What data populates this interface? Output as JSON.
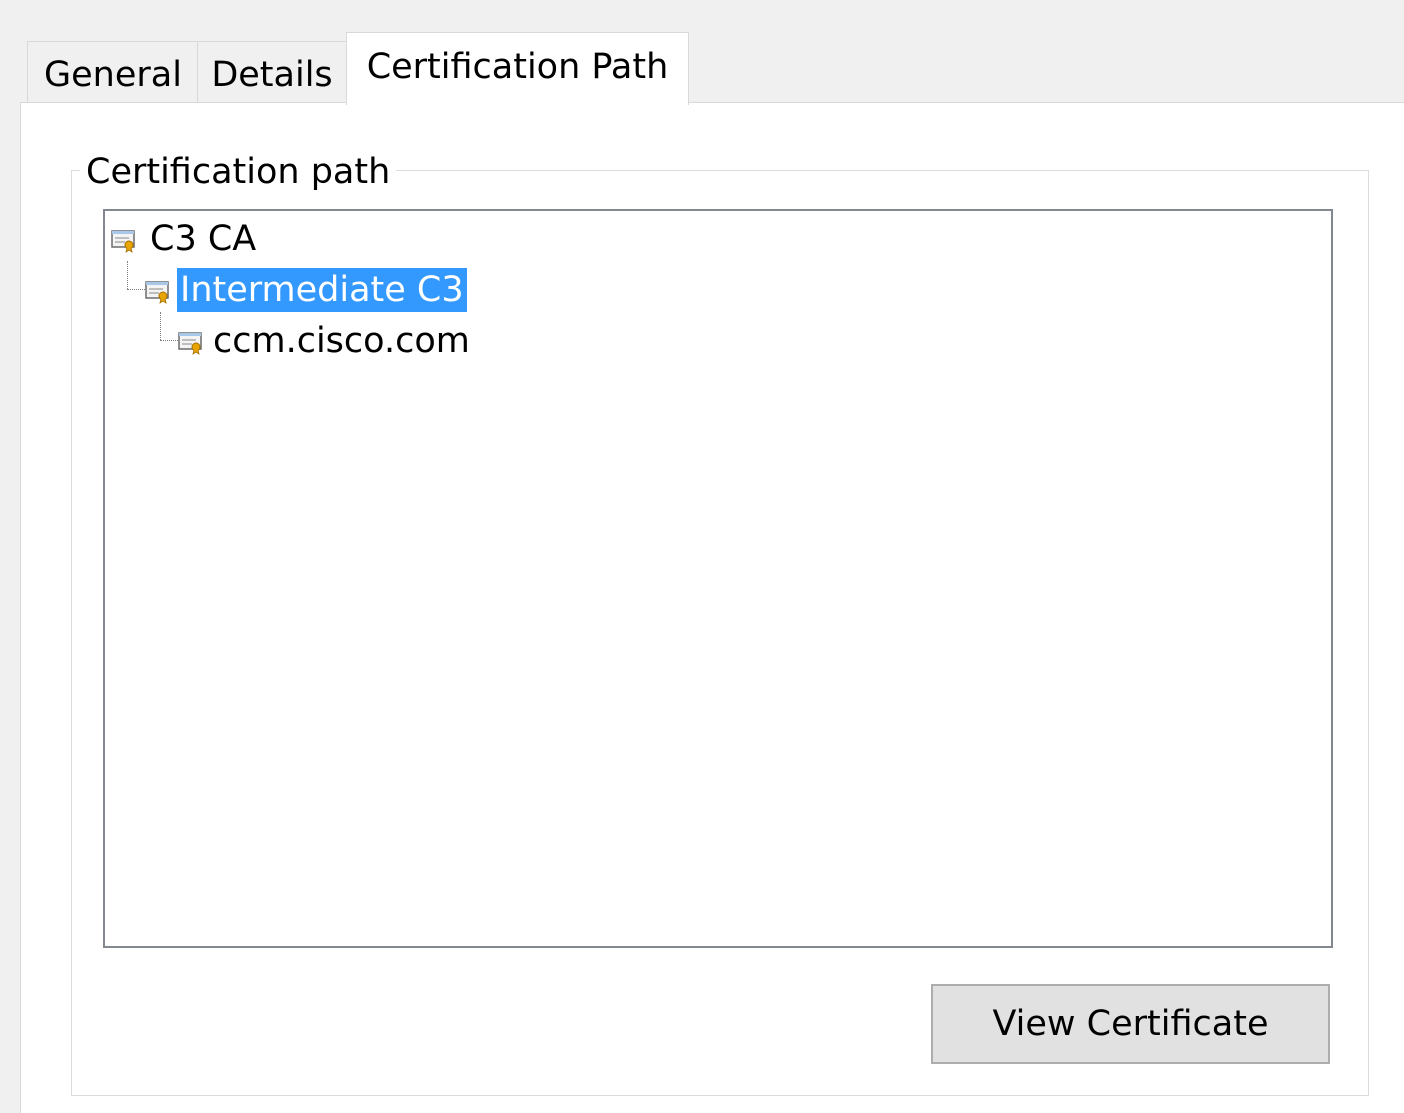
{
  "tabs": [
    {
      "label": "General",
      "active": false
    },
    {
      "label": "Details",
      "active": false
    },
    {
      "label": "Certification Path",
      "active": true
    }
  ],
  "certification_path": {
    "group_title": "Certification path",
    "nodes": [
      {
        "label": "C3 CA",
        "level": 0,
        "selected": false,
        "icon": "certificate-icon"
      },
      {
        "label": "Intermediate C3",
        "level": 1,
        "selected": true,
        "icon": "certificate-icon"
      },
      {
        "label": "ccm.cisco.com",
        "level": 2,
        "selected": false,
        "icon": "certificate-icon"
      }
    ]
  },
  "buttons": {
    "view_certificate": "View Certificate"
  },
  "colors": {
    "selection": "#3399ff",
    "selection_text": "#ffffff",
    "background": "#f0f0f0",
    "panel": "#ffffff"
  }
}
